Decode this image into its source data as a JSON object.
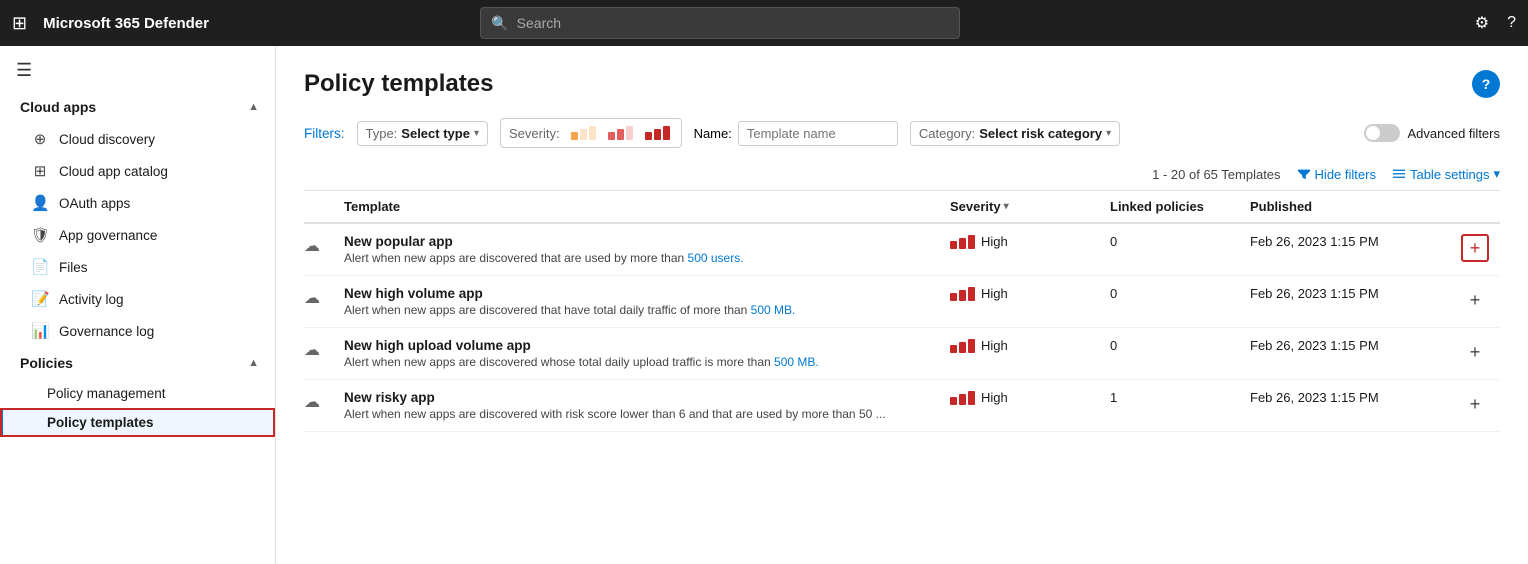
{
  "topbar": {
    "app_title": "Microsoft 365 Defender",
    "search_placeholder": "Search",
    "gear_icon": "⚙",
    "help_icon": "?"
  },
  "sidebar": {
    "hamburger_icon": "☰",
    "sections": [
      {
        "label": "Cloud apps",
        "expanded": true,
        "items": [
          {
            "label": "Cloud discovery",
            "icon": "🔍",
            "active": false
          },
          {
            "label": "Cloud app catalog",
            "icon": "📋",
            "active": false
          },
          {
            "label": "OAuth apps",
            "icon": "👤",
            "active": false
          },
          {
            "label": "App governance",
            "icon": "🛡",
            "active": false
          },
          {
            "label": "Files",
            "icon": "📄",
            "active": false
          },
          {
            "label": "Activity log",
            "icon": "📝",
            "active": false
          },
          {
            "label": "Governance log",
            "icon": "📊",
            "active": false
          },
          {
            "label": "Policies",
            "icon": "⚙",
            "active": false,
            "expanded": true,
            "children": [
              {
                "label": "Policy management",
                "active": false
              },
              {
                "label": "Policy templates",
                "active": true
              }
            ]
          }
        ]
      }
    ]
  },
  "content": {
    "page_title": "Policy templates",
    "help_button": "?",
    "filters_label": "Filters:",
    "type_filter_label": "Type:",
    "type_filter_value": "Select type",
    "severity_label": "Severity:",
    "name_label": "Name:",
    "name_placeholder": "Template name",
    "category_label": "Category:",
    "category_value": "Select risk category",
    "advanced_filters_label": "Advanced filters",
    "table_count": "1 - 20 of 65 Templates",
    "hide_filters_label": "Hide filters",
    "table_settings_label": "Table settings",
    "columns": {
      "template": "Template",
      "severity": "Severity",
      "linked_policies": "Linked policies",
      "published": "Published"
    },
    "rows": [
      {
        "icon": "☁",
        "name": "New popular app",
        "desc_plain": "Alert when new apps are discovered that are used by more than ",
        "desc_link": "500 users.",
        "severity_level": "High",
        "severity_bars": 3,
        "linked": "0",
        "published": "Feb 26, 2023 1:15 PM",
        "add_highlighted": true
      },
      {
        "icon": "☁",
        "name": "New high volume app",
        "desc_plain": "Alert when new apps are discovered that have total daily traffic of more than ",
        "desc_link": "500 MB.",
        "severity_level": "High",
        "severity_bars": 3,
        "linked": "0",
        "published": "Feb 26, 2023 1:15 PM",
        "add_highlighted": false
      },
      {
        "icon": "☁",
        "name": "New high upload volume app",
        "desc_plain": "Alert when new apps are discovered whose total daily upload traffic is more than ",
        "desc_link": "500 MB.",
        "severity_level": "High",
        "severity_bars": 3,
        "linked": "0",
        "published": "Feb 26, 2023 1:15 PM",
        "add_highlighted": false
      },
      {
        "icon": "☁",
        "name": "New risky app",
        "desc_plain": "Alert when new apps are discovered with risk score lower than 6 and that are used by more than 50 ...",
        "desc_link": "",
        "severity_level": "High",
        "severity_bars": 3,
        "linked": "1",
        "published": "Feb 26, 2023 1:15 PM",
        "add_highlighted": false
      }
    ]
  }
}
